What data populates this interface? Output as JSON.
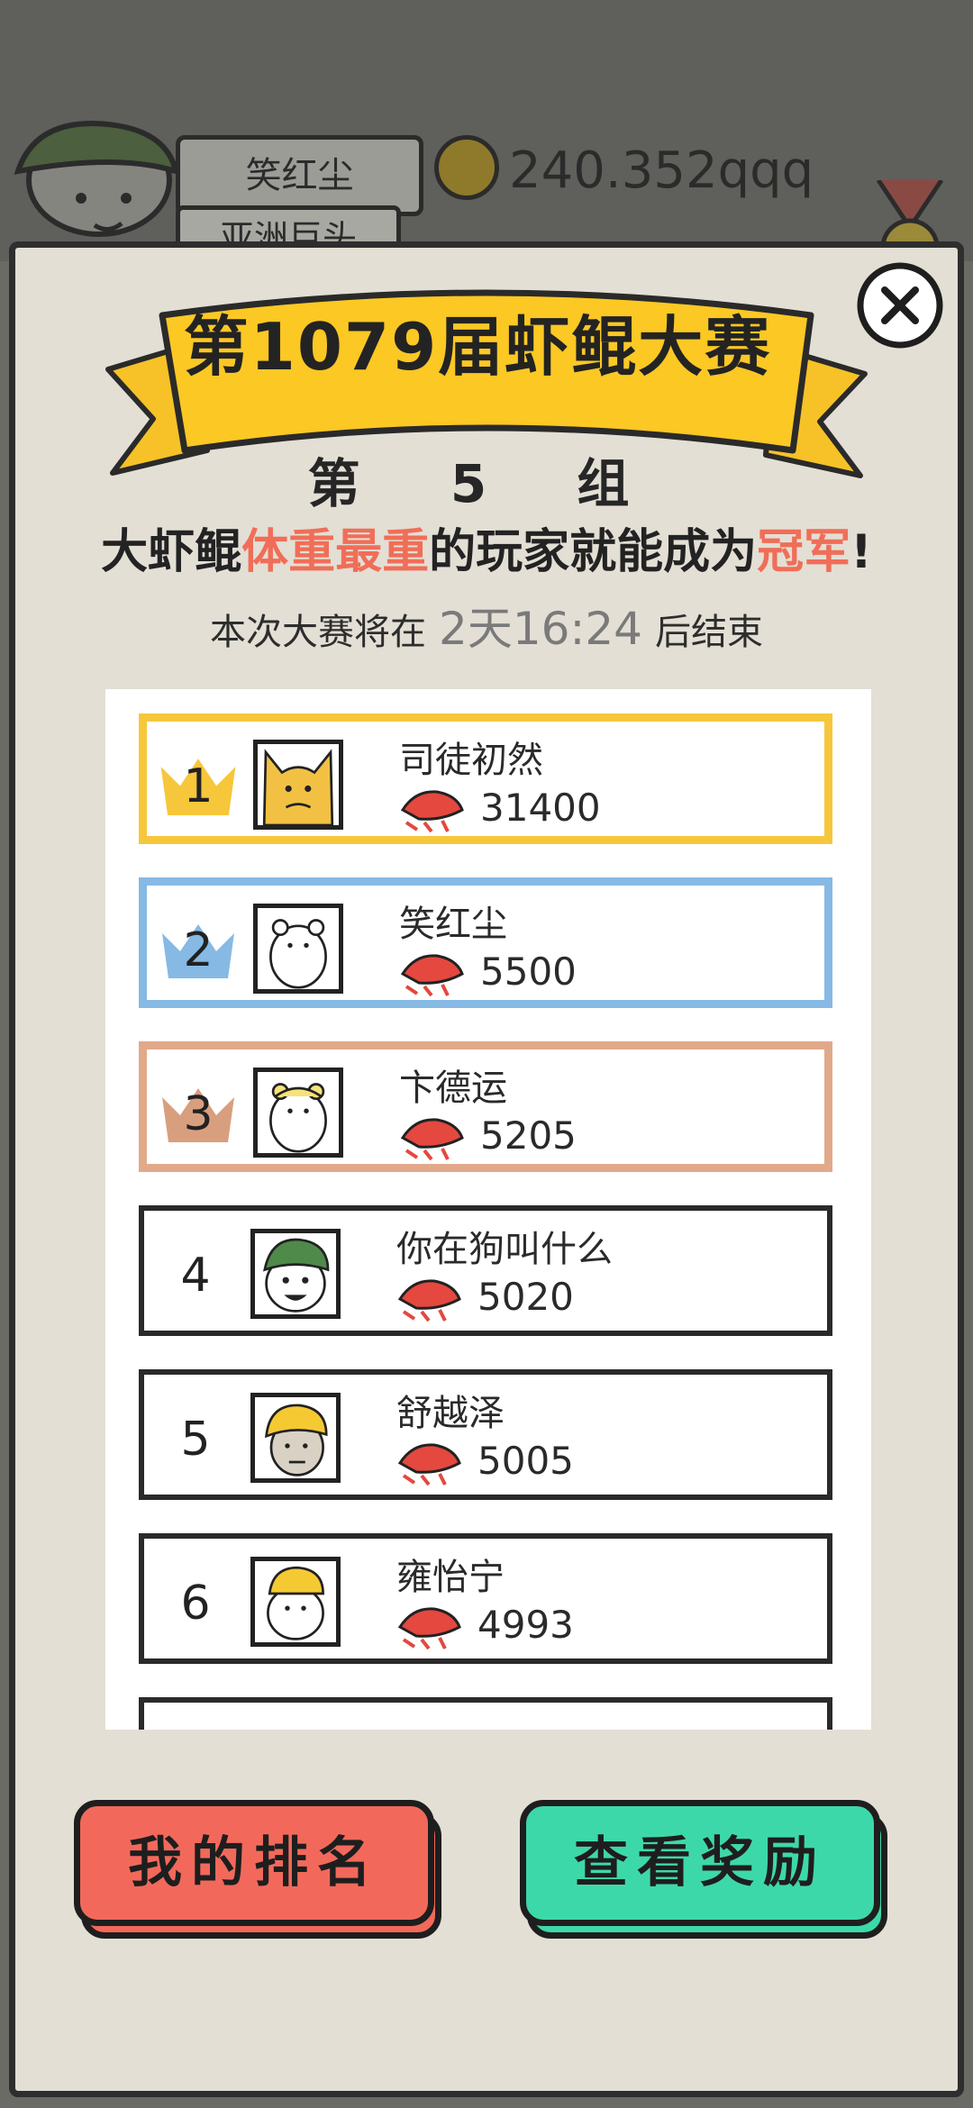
{
  "hud": {
    "player_name": "笑红尘",
    "player_title": "亚洲巨头",
    "coins": "240.352qqq"
  },
  "banner": {
    "title": "第1079届虾鲲大赛"
  },
  "group": {
    "label": "第 5 组"
  },
  "rule": {
    "part1": "大虾鲲",
    "highlight1": "体重最重",
    "part2": "的玩家就能成为",
    "highlight2": "冠军",
    "part3": "!"
  },
  "countdown": {
    "prefix": "本次大赛将在",
    "time": "2天16:24",
    "suffix": "后结束"
  },
  "leaderboard": [
    {
      "rank": "1",
      "name": "司徒初然",
      "score": "31400"
    },
    {
      "rank": "2",
      "name": "笑红尘",
      "score": "5500"
    },
    {
      "rank": "3",
      "name": "卞德运",
      "score": "5205"
    },
    {
      "rank": "4",
      "name": "你在狗叫什么",
      "score": "5020"
    },
    {
      "rank": "5",
      "name": "舒越泽",
      "score": "5005"
    },
    {
      "rank": "6",
      "name": "雍怡宁",
      "score": "4993"
    }
  ],
  "buttons": {
    "my_rank": "我的排名",
    "view_rewards": "查看奖励"
  },
  "colors": {
    "gold": "#f6c73b",
    "silver": "#86b9e4",
    "bronze": "#e1a98a",
    "highlight": "#f06e58",
    "my_rank_button": "#f2695b",
    "reward_button": "#3dd8a9"
  }
}
